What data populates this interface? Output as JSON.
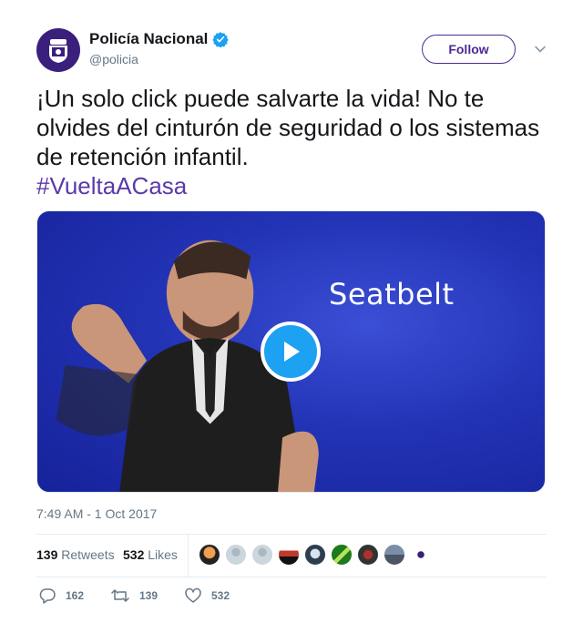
{
  "account": {
    "display_name": "Policía Nacional",
    "handle": "@policia",
    "verified": true,
    "follow_label": "Follow",
    "brand_color": "#4b2b93"
  },
  "tweet": {
    "text": "¡Un solo click puede salvarte la vida! No te olvides del cinturón de seguridad o los sistemas de retención infantil.",
    "hashtag": "#VueltaACasa",
    "timestamp": "7:49 AM - 1 Oct 2017"
  },
  "media": {
    "caption": "Seatbelt",
    "play_icon": "play-icon"
  },
  "stats": {
    "retweets_count": "139",
    "retweets_label": "Retweets",
    "likes_count": "532",
    "likes_label": "Likes"
  },
  "actions": {
    "replies": "162",
    "retweets": "139",
    "likes": "532"
  }
}
